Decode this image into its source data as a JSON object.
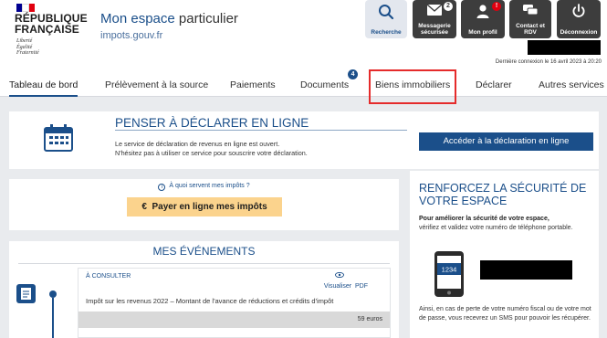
{
  "brand": {
    "republic_line1": "RÉPUBLIQUE",
    "republic_line2": "FRANÇAISE",
    "motto_1": "Liberté",
    "motto_2": "Égalité",
    "motto_3": "Fraternité",
    "site_title_strong": "Mon espace",
    "site_title_light": "particulier",
    "site_url": "impots.gouv.fr",
    "flag_colors": [
      "#000091",
      "#ffffff",
      "#e1000f"
    ]
  },
  "header_buttons": {
    "search": {
      "label": "Recherche",
      "icon": "search-icon"
    },
    "messaging": {
      "label_1": "Messagerie",
      "label_2": "sécurisée",
      "badge": "2",
      "icon": "envelope-icon"
    },
    "profile": {
      "label": "Mon profil",
      "badge": "!",
      "icon": "user-icon"
    },
    "contact": {
      "label_1": "Contact et",
      "label_2": "RDV",
      "icon": "chat-icon"
    },
    "logout": {
      "label": "Déconnexion",
      "icon": "power-icon"
    }
  },
  "last_connection": "Dernière connexion le 16 avril 2023 à 20:20",
  "nav": {
    "tabs": [
      {
        "label": "Tableau de bord"
      },
      {
        "label": "Prélèvement à la source"
      },
      {
        "label": "Paiements"
      },
      {
        "label": "Documents",
        "badge": "4"
      },
      {
        "label": "Biens immobiliers"
      },
      {
        "label": "Déclarer"
      },
      {
        "label": "Autres services"
      }
    ]
  },
  "banner": {
    "title": "Penser à déclarer en ligne",
    "text_1": "Le service de déclaration de revenus en ligne est ouvert.",
    "text_2": "N'hésitez pas à utiliser ce service pour souscrire votre déclaration.",
    "button": "Accéder à la déclaration en ligne"
  },
  "payment": {
    "info_link": "À quoi servent mes impôts ?",
    "button": "Payer en ligne mes impôts",
    "button_symbol": "€"
  },
  "events": {
    "title": "Mes événements",
    "card": {
      "tag": "À consulter",
      "view_label": "Visualiser",
      "view_format": "PDF",
      "description": "Impôt sur les revenus 2022 – Montant de l'avance de réductions et crédits d'impôt",
      "amount": "59 euros"
    }
  },
  "security": {
    "title_1": "Renforcez la sécurité de",
    "title_2": "votre espace",
    "bold_text": "Pour améliorer la sécurité de votre espace,",
    "text_1": "vérifiez et validez votre numéro de téléphone portable.",
    "phone_code": "1234",
    "text_2": "Ainsi, en cas de perte de votre numéro fiscal ou de votre mot de passe, vous recevrez un SMS pour pouvoir les récupérer."
  },
  "colors": {
    "primary": "#1b4f8a",
    "highlight": "#e52b2b",
    "pay_button": "#fbd38d",
    "dark_button": "#3d3d3d"
  }
}
